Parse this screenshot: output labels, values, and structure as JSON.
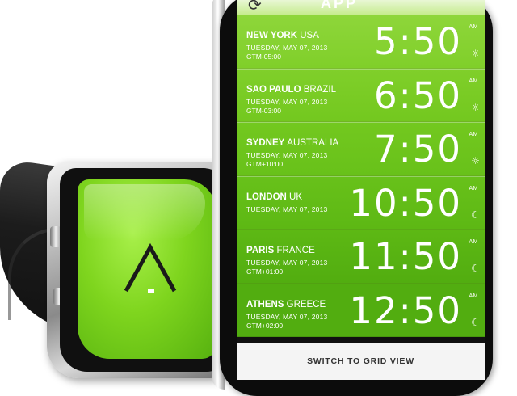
{
  "app": {
    "title": "APP"
  },
  "icons": {
    "refresh": "refresh-icon",
    "sun": "sun-icon",
    "moon": "moon-icon"
  },
  "colors": {
    "accent_green": "#7ed321",
    "dark_green": "#2f8f0a",
    "footer_bg": "#f4f4f4"
  },
  "cities": [
    {
      "city": "NEW YORK",
      "country": "USA",
      "date": "TUESDAY, MAY 07, 2013",
      "tz": "GTM-05:00",
      "time": "5:50",
      "ampm": "AM",
      "icon": "sun"
    },
    {
      "city": "SAO PAULO",
      "country": "BRAZIL",
      "date": "TUESDAY, MAY 07, 2013",
      "tz": "GTM-03:00",
      "time": "6:50",
      "ampm": "AM",
      "icon": "sun"
    },
    {
      "city": "SYDNEY",
      "country": "AUSTRALIA",
      "date": "TUESDAY, MAY 07, 2013",
      "tz": "GTM+10:00",
      "time": "7:50",
      "ampm": "AM",
      "icon": "sun"
    },
    {
      "city": "LONDON",
      "country": "UK",
      "date": "TUESDAY, MAY 07, 2013",
      "tz": "",
      "time": "10:50",
      "ampm": "AM",
      "icon": "moon"
    },
    {
      "city": "PARIS",
      "country": "FRANCE",
      "date": "TUESDAY, MAY 07, 2013",
      "tz": "GTM+01:00",
      "time": "11:50",
      "ampm": "AM",
      "icon": "moon"
    },
    {
      "city": "ATHENS",
      "country": "GREECE",
      "date": "TUESDAY, MAY 07, 2013",
      "tz": "GTM+02:00",
      "time": "12:50",
      "ampm": "AM",
      "icon": "moon"
    }
  ],
  "footer": {
    "switch_label": "SWITCH TO GRID VIEW"
  }
}
